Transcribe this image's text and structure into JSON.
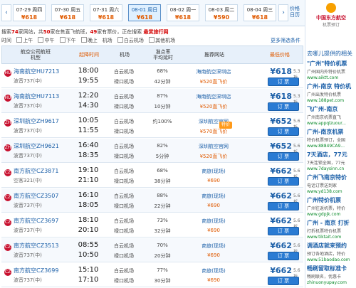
{
  "dates": [
    {
      "date": "07-29 周四",
      "price": "¥618"
    },
    {
      "date": "07-30 周五",
      "price": "¥618"
    },
    {
      "date": "07-31 周六",
      "price": "¥618"
    },
    {
      "date": "08-01 周日",
      "price": "¥618"
    },
    {
      "date": "08-02 周一",
      "price": "¥618"
    },
    {
      "date": "08-03 周二",
      "price": "¥590"
    },
    {
      "date": "08-04 周三",
      "price": "¥618"
    }
  ],
  "nav": {
    "prev": "‹",
    "next": "›",
    "price_tip": "价格日历"
  },
  "info": {
    "a": "搜索",
    "count1": "74",
    "b": "家网站，共",
    "count2": "50",
    "c": "家在售直飞航班，",
    "count3": "49",
    "d": "家有票价，正在搜索",
    "searching": "悬赏旅行网"
  },
  "filters": {
    "time_label": "时间",
    "morning": "上午",
    "noon": "中午",
    "afternoon": "下午",
    "evening": "晚上",
    "airport_label": "机场",
    "ap1": "白云机场",
    "ap2": "其他机场",
    "more": "更多筛选条件"
  },
  "headers": {
    "flight": "航空公司航班\n机型",
    "time": "起降时间",
    "airport": "机场",
    "rate": "准点率\n平均延时",
    "site": "推荐网站",
    "price": "最低价格"
  },
  "rows": [
    {
      "flight": "海南航空HU7213",
      "plane": "波音737(中)",
      "dep": "18:00",
      "arr": "19:55",
      "apdep": "白云机场",
      "aparr": "禄口机场",
      "rate": "68%",
      "delay": "42分钟",
      "site": "海南航空深圳店",
      "save": "¥520直飞价",
      "price": "¥618",
      "disc": "5.3折",
      "book": "订 票",
      "logo": "HU"
    },
    {
      "flight": "海南航空HU7113",
      "plane": "波音737(中)",
      "dep": "12:20",
      "arr": "14:30",
      "apdep": "白云机场",
      "aparr": "禄口机场",
      "rate": "87%",
      "delay": "10分钟",
      "site": "海南航空深圳店",
      "save": "¥520直飞价",
      "price": "¥618",
      "disc": "5.3折",
      "book": "订 票",
      "logo": "HU"
    },
    {
      "flight": "深圳航空ZH9617",
      "plane": "波音737(中)",
      "dep": "10:05",
      "arr": "11:55",
      "apdep": "白云机场",
      "aparr": "禄口机场",
      "rate": "约100%",
      "delay": "",
      "site": "深圳航空官网",
      "save": "¥570直飞价",
      "price": "¥652",
      "disc": "5.6折",
      "book": "订 票",
      "logo": "ZH",
      "badge": "特价"
    },
    {
      "flight": "深圳航空ZH9621",
      "plane": "波音737(中)",
      "dep": "16:40",
      "arr": "18:35",
      "apdep": "白云机场",
      "aparr": "禄口机场",
      "rate": "82%",
      "delay": "5分钟",
      "site": "深圳航空官网",
      "save": "¥520直飞价",
      "price": "¥652",
      "disc": "5.6折",
      "book": "订 票",
      "logo": "ZH"
    },
    {
      "flight": "南方航空CZ3871",
      "plane": "空客321(中)",
      "dep": "19:10",
      "arr": "21:10",
      "apdep": "白云机场",
      "aparr": "禄口机场",
      "rate": "68%",
      "delay": "38分钟",
      "site": "商旅(现场)",
      "save": "¥690",
      "price": "¥662",
      "disc": "5.6折",
      "book": "订 票",
      "logo": "CZ"
    },
    {
      "flight": "南方航空CZ3507",
      "plane": "波音737(中)",
      "dep": "16:10",
      "arr": "18:05",
      "apdep": "白云机场",
      "aparr": "禄口机场",
      "rate": "88%",
      "delay": "22分钟",
      "site": "商旅(现场)",
      "save": "¥690",
      "price": "¥662",
      "disc": "5.6折",
      "book": "订 票",
      "logo": "CZ"
    },
    {
      "flight": "南方航空CZ3697",
      "plane": "波音737(中)",
      "dep": "18:10",
      "arr": "20:10",
      "apdep": "白云机场",
      "aparr": "禄口机场",
      "rate": "73%",
      "delay": "32分钟",
      "site": "商旅(现场)",
      "save": "¥690",
      "price": "¥662",
      "disc": "5.6折",
      "book": "订 票",
      "logo": "CZ"
    },
    {
      "flight": "南方航空CZ3513",
      "plane": "波音737(中)",
      "dep": "08:55",
      "arr": "10:50",
      "apdep": "白云机场",
      "aparr": "禄口机场",
      "rate": "70%",
      "delay": "20分钟",
      "site": "商旅(现场)",
      "save": "¥690",
      "price": "¥662",
      "disc": "5.6折",
      "book": "订 票",
      "logo": "CZ"
    },
    {
      "flight": "南方航空CZ3699",
      "plane": "波音737(中)",
      "dep": "15:10",
      "arr": "17:10",
      "apdep": "白云机场",
      "aparr": "禄口机场",
      "rate": "77%",
      "delay": "30分钟",
      "site": "商旅(现场)",
      "save": "¥690",
      "price": "¥662",
      "disc": "5.6折",
      "book": "订 票",
      "logo": "CZ"
    }
  ],
  "side": {
    "brand": "中国东方航空",
    "brand_sub": "机票预订",
    "intro": "去哪儿提供的相关",
    "ads": [
      {
        "title": "\"广州\"特价机票",
        "sub": "广州国内外特价机票",
        "url": "www.aiktt.com"
      },
      {
        "title": "广州-南京 特价机",
        "sub": "广州出发特价机票",
        "url": "www.188pet.com"
      },
      {
        "title": "飞广州-南京",
        "sub": "广州南京机票直飞",
        "url": "www.appqlzuour..."
      },
      {
        "title": "广州-南京机票",
        "sub": "特价机票预订，全国",
        "url": "www.88849CA9..."
      },
      {
        "title": "7天酒店，77元",
        "sub": "7天连锁全国，77元",
        "url": "www.7daysinn.cn"
      },
      {
        "title": "广州飞南京特价",
        "sub": "电话订票送到家",
        "url": "www.yd138.com"
      },
      {
        "title": "广州特价机票",
        "sub": "广州往返机票，特价",
        "url": "www.gdpjk.com"
      },
      {
        "title": "广州 - 南京 打折",
        "sub": "打折机票特价机票",
        "url": "www.tiktait.com"
      },
      {
        "title": "调酒店就来预约",
        "sub": "预订各地酒店，特价",
        "url": "www.51baodao.com"
      },
      {
        "title": "畅刷留取标准卡",
        "sub": "畅刷联名，优惠卡",
        "url": "zhinuonyupay.com"
      }
    ]
  }
}
